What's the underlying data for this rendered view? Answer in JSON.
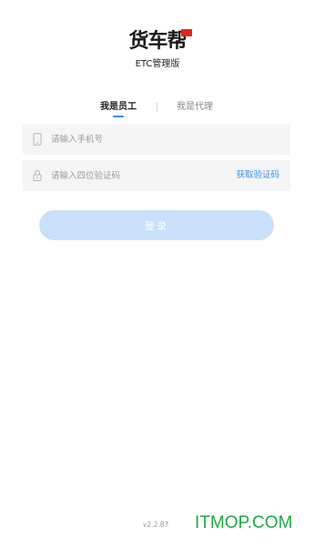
{
  "brand": {
    "logo_text": "货车帮",
    "subtitle": "ETC管理版"
  },
  "tabs": [
    {
      "label": "我是员工",
      "active": true
    },
    {
      "label": "我是代理",
      "active": false
    }
  ],
  "phone_field": {
    "placeholder": "请输入手机号",
    "value": "",
    "icon": "phone-icon"
  },
  "code_field": {
    "placeholder": "请输入四位验证码",
    "value": "",
    "icon": "lock-icon",
    "action_label": "获取验证码"
  },
  "login_button": {
    "label": "登录",
    "enabled": false
  },
  "footer": {
    "version": "v2.2.87",
    "watermark": "ITMOP.COM"
  },
  "colors": {
    "accent": "#3a8ee6",
    "button_disabled": "#c9e0fb",
    "field_bg": "#f5f5f5",
    "logo_flag": "#e1251b",
    "watermark": "#1fa845"
  }
}
